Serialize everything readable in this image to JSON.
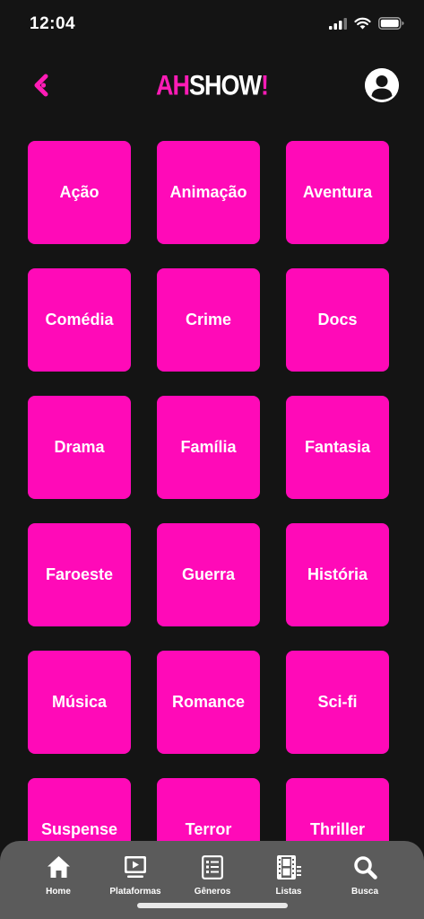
{
  "status_bar": {
    "time": "12:04"
  },
  "header": {
    "logo_ah": "AH",
    "logo_show": "SHOW",
    "logo_bang": "!"
  },
  "genres": [
    "Ação",
    "Animação",
    "Aventura",
    "Comédia",
    "Crime",
    "Docs",
    "Drama",
    "Família",
    "Fantasia",
    "Faroeste",
    "Guerra",
    "História",
    "Música",
    "Romance",
    "Sci-fi",
    "Suspense",
    "Terror",
    "Thriller"
  ],
  "nav": {
    "home": "Home",
    "platforms": "Plataformas",
    "genres": "Gêneros",
    "lists": "Listas",
    "search": "Busca"
  },
  "icons": {
    "back": "chevron-left-icon",
    "profile": "user-avatar-icon",
    "home": "home-icon",
    "platforms": "tv-icon",
    "genres": "document-list-icon",
    "lists": "film-strip-icon",
    "search": "search-icon"
  },
  "colors": {
    "accent": "#ff0ab8",
    "background": "#141414",
    "nav_background": "#5b5b5b"
  }
}
